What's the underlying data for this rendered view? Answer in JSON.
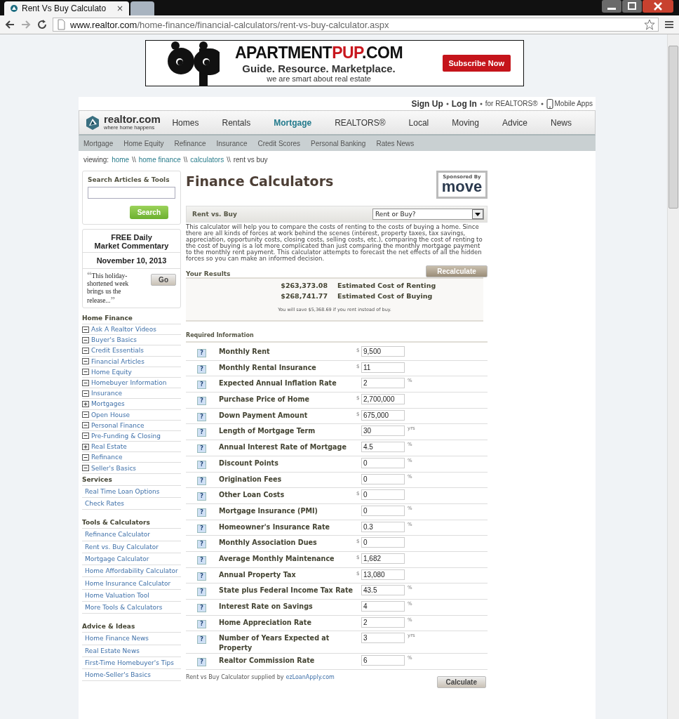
{
  "browser": {
    "tabs": [
      {
        "title": "Rent Vs Buy Calculato",
        "close": "×",
        "selected": true
      },
      {
        "selected": false
      }
    ],
    "url_host": "www.realtor.com",
    "url_path": "/home-finance/financial-calculators/rent-vs-buy-calculator.aspx"
  },
  "ad": {
    "brand_parts": [
      {
        "text": "APARTMENT",
        "highlight": false
      },
      {
        "text": "PUP",
        "highlight": true
      },
      {
        "text": ".COM",
        "highlight": false
      }
    ],
    "tagline": "Guide. Resource. Marketplace.",
    "subline": "we are smart about real estate",
    "button": "Subscribe Now"
  },
  "top_links": [
    {
      "label": "Sign Up",
      "kind": "strong"
    },
    {
      "label": "Log In",
      "kind": "strong"
    },
    {
      "label": "for REALTORS®",
      "kind": "plain"
    },
    {
      "label": "Mobile Apps",
      "kind": "phone"
    }
  ],
  "logo": {
    "name": "realtor.com",
    "tagline": "where home happens"
  },
  "nav": [
    {
      "label": "Homes",
      "selected": false
    },
    {
      "label": "Rentals",
      "selected": false
    },
    {
      "label": "Mortgage",
      "selected": true
    },
    {
      "label": "REALTORS®",
      "selected": false
    },
    {
      "label": "Local",
      "selected": false
    },
    {
      "label": "Moving",
      "selected": false
    },
    {
      "label": "Advice",
      "selected": false
    },
    {
      "label": "News",
      "selected": false
    }
  ],
  "subnav": [
    "Mortgage",
    "Home Equity",
    "Refinance",
    "Insurance",
    "Credit Scores",
    "Personal Banking",
    "Rates News"
  ],
  "breadcrumb": {
    "label": "viewing:",
    "links": [
      "home",
      "home finance",
      "calculators"
    ],
    "current": "rent vs buy",
    "separator": "\\\\"
  },
  "sidebar": {
    "search": {
      "title": "Search Articles & Tools",
      "button": "Search"
    },
    "commentary": {
      "title": "FREE Daily\nMarket Commentary",
      "date": "November 10, 2013",
      "open_quote": "“",
      "excerpt": "This holiday-shortened week brings us the release...",
      "close_quote": "”",
      "button": "Go"
    },
    "sections": [
      {
        "title": "Home Finance",
        "items": [
          {
            "label": "Ask A Realtor Videos",
            "expanded": true
          },
          {
            "label": "Buyer's Basics",
            "expanded": true
          },
          {
            "label": "Credit Essentials",
            "expanded": true
          },
          {
            "label": "Financial Articles",
            "expanded": true
          },
          {
            "label": "Home Equity",
            "expanded": true
          },
          {
            "label": "Homebuyer Information",
            "expanded": true
          },
          {
            "label": "Insurance",
            "expanded": true
          },
          {
            "label": "Mortgages",
            "expanded": false
          },
          {
            "label": "Open House",
            "expanded": true
          },
          {
            "label": "Personal Finance",
            "expanded": true
          },
          {
            "label": "Pre-Funding & Closing",
            "expanded": true
          },
          {
            "label": "Real Estate",
            "expanded": false
          },
          {
            "label": "Refinance",
            "expanded": true
          },
          {
            "label": "Seller's Basics",
            "expanded": true
          }
        ]
      },
      {
        "title": "Services",
        "items": [
          {
            "label": "Real Time Loan Options"
          },
          {
            "label": "Check Rates"
          }
        ]
      },
      {
        "title": "Tools & Calculators",
        "items": [
          {
            "label": "Refinance Calculator"
          },
          {
            "label": "Rent vs. Buy Calculator"
          },
          {
            "label": "Mortgage Calculator"
          },
          {
            "label": "Home Affordability Calculator"
          },
          {
            "label": "Home Insurance Calculator"
          },
          {
            "label": "Home Valuation Tool"
          },
          {
            "label": "More Tools & Calculators"
          }
        ]
      },
      {
        "title": "Advice & Ideas",
        "items": [
          {
            "label": "Home Finance News"
          },
          {
            "label": "Real Estate News"
          },
          {
            "label": "First-Time Homebuyer's Tips"
          },
          {
            "label": "Home-Seller's Basics"
          }
        ]
      }
    ]
  },
  "main": {
    "title": "Finance Calculators",
    "sponsor": {
      "label": "Sponsored By",
      "brand": "move"
    },
    "calculator_bar": {
      "title": "Rent vs. Buy",
      "dropdown": "Rent or Buy?"
    },
    "description": "This calculator will help you to compare the costs of renting to the costs of buying a home. Since there are all kinds of forces at work behind the scenes (interest, property taxes, tax savings, appreciation, opportunity costs, closing costs, selling costs, etc.), comparing the cost of renting to the cost of buying is a lot more complicated than just comparing the monthly mortgage payment to the monthly rent payment. This calculator attempts to forecast the net effects of all the hidden forces so you can make an informed decision.",
    "recalculate": "Recalculate",
    "results_title": "Your Results",
    "results": [
      {
        "amount": "$263,373.08",
        "label": "Estimated Cost of Renting"
      },
      {
        "amount": "$268,741.77",
        "label": "Estimated Cost of Buying"
      }
    ],
    "savings_note": "You will save $5,368.69 if you rent instead of buy.",
    "required_title": "Required Information",
    "help": "?",
    "fields": [
      {
        "label": "Monthly Rent",
        "prefix": "$",
        "value": "9,500"
      },
      {
        "label": "Monthly Rental Insurance",
        "prefix": "$",
        "value": "11"
      },
      {
        "label": "Expected Annual Inflation Rate",
        "suffix": "%",
        "value": "2"
      },
      {
        "label": "Purchase Price of Home",
        "prefix": "$",
        "value": "2,700,000"
      },
      {
        "label": "Down Payment Amount",
        "prefix": "$",
        "value": "675,000"
      },
      {
        "label": "Length of Mortgage Term",
        "suffix": "yrs",
        "value": "30"
      },
      {
        "label": "Annual Interest Rate of Mortgage",
        "suffix": "%",
        "value": "4.5"
      },
      {
        "label": "Discount Points",
        "suffix": "%",
        "value": "0"
      },
      {
        "label": "Origination Fees",
        "suffix": "%",
        "value": "0"
      },
      {
        "label": "Other Loan Costs",
        "prefix": "$",
        "value": "0"
      },
      {
        "label": "Mortgage Insurance (PMI)",
        "suffix": "%",
        "value": "0"
      },
      {
        "label": "Homeowner's Insurance Rate",
        "suffix": "%",
        "value": "0.3"
      },
      {
        "label": "Monthly Association Dues",
        "prefix": "$",
        "value": "0"
      },
      {
        "label": "Average Monthly Maintenance",
        "prefix": "$",
        "value": "1,682"
      },
      {
        "label": "Annual Property Tax",
        "prefix": "$",
        "value": "13,080"
      },
      {
        "label": "State plus Federal Income Tax Rate",
        "suffix": "%",
        "value": "43.5"
      },
      {
        "label": "Interest Rate on Savings",
        "suffix": "%",
        "value": "4"
      },
      {
        "label": "Home Appreciation Rate",
        "suffix": "%",
        "value": "2"
      },
      {
        "label": "Number of Years Expected at Property",
        "suffix": "yrs",
        "value": "3"
      },
      {
        "label": "Realtor Commission Rate",
        "suffix": "%",
        "value": "6"
      }
    ],
    "credit": "Rent vs Buy Calculator supplied by",
    "credit_link": "ezLoanApply.com",
    "calculate": "Calculate"
  }
}
